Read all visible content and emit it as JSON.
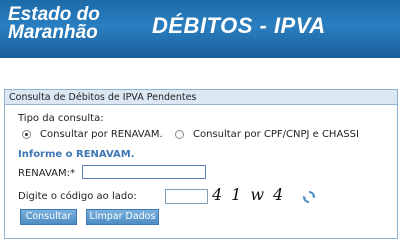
{
  "header": {
    "state_line1": "Estado do",
    "state_line2": "Maranhão",
    "title": "DÉBITOS - IPVA"
  },
  "panel": {
    "title": "Consulta de Débitos de IPVA Pendentes",
    "query_type_label": "Tipo da consulta:",
    "options": [
      {
        "label": "Consultar por RENAVAM.",
        "selected": true
      },
      {
        "label": "Consultar por CPF/CNPJ e CHASSI",
        "selected": false
      }
    ],
    "info_text": "Informe o RENAVAM.",
    "renavam_label": "RENAVAM:*",
    "renavam_value": "",
    "captcha_label": "Digite o código ao lado:",
    "captcha_value": "",
    "captcha_code": "41w4",
    "refresh_icon": "refresh-icon",
    "buttons": {
      "consultar": "Consultar",
      "limpar": "Limpar Dados"
    }
  },
  "colors": {
    "header": "#1d6aa8",
    "accent": "#3c78b5",
    "panel_title_bg": "#dbe8f3"
  }
}
